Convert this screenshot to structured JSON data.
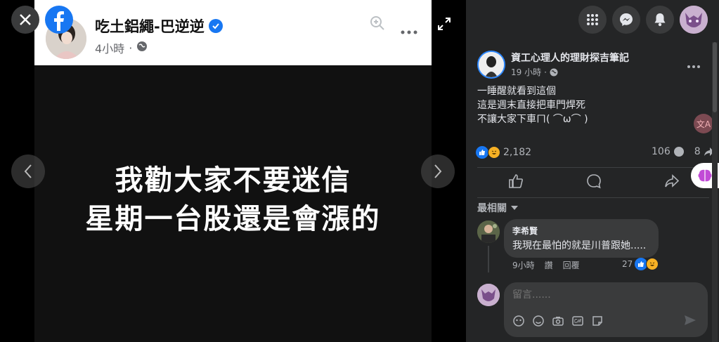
{
  "photo": {
    "author": "吃土鋁繩-巴逆逆",
    "time": "4小時",
    "text_line1": "我勸大家不要迷信",
    "text_line2": "星期一台股還是會漲的"
  },
  "post": {
    "author": "資工心理人的理財探吉筆記",
    "time": "19 小時",
    "body_line1": "一睡醒就看到這個",
    "body_line2": "這是週末直接把車門焊死",
    "body_line3": "不讓大家下車ㄇ( ⌒ω⌒ )",
    "translate_label": "文A",
    "reaction_count": "2,182",
    "comment_count": "106",
    "share_count": "8"
  },
  "comments": {
    "sort_label": "最相關",
    "items": [
      {
        "name": "李希賢",
        "text": "我現在最怕的就是川普跟她.....",
        "time": "9小時",
        "like_label": "讚",
        "reply_label": "回覆",
        "reaction_count": "27"
      }
    ]
  },
  "composer": {
    "placeholder": "留言......"
  },
  "colors": {
    "accent": "#1877f2",
    "panel_bg": "#242526",
    "bubble_bg": "#3a3b3c"
  },
  "icons": [
    "close-icon",
    "facebook-logo-icon",
    "zoom-in-icon",
    "more-icon",
    "globe-icon",
    "verified-icon",
    "chevron-left-icon",
    "chevron-right-icon",
    "expand-icon",
    "grid-menu-icon",
    "messenger-icon",
    "bell-icon",
    "like-icon",
    "comment-icon",
    "share-icon",
    "send-icon",
    "emoji-icon",
    "camera-icon",
    "gif-icon",
    "sticker-icon",
    "translate-icon",
    "brain-icon"
  ]
}
